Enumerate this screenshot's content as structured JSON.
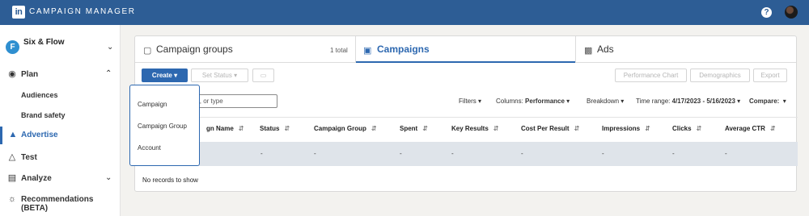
{
  "header": {
    "logo_text": "in",
    "app_title": "CAMPAIGN MANAGER",
    "help_label": "?"
  },
  "sidebar": {
    "account_name": "Six & Flow",
    "account_initial": "F",
    "items": [
      {
        "label": "Plan",
        "icon": "compass-icon"
      },
      {
        "label": "Audiences"
      },
      {
        "label": "Brand safety"
      },
      {
        "label": "Advertise",
        "icon": "megaphone-icon"
      },
      {
        "label": "Test",
        "icon": "flask-icon"
      },
      {
        "label": "Analyze",
        "icon": "bar-chart-icon"
      },
      {
        "label": "Recommendations (BETA)",
        "icon": "lightbulb-icon"
      }
    ]
  },
  "tabs": [
    {
      "label": "Campaign groups",
      "count": "1 total"
    },
    {
      "label": "Campaigns"
    },
    {
      "label": "Ads"
    }
  ],
  "toolbar": {
    "create": "Create",
    "set_status": "Set Status",
    "performance_chart": "Performance Chart",
    "demographics": "Demographics",
    "export": "Export"
  },
  "search": {
    "value": "D, or type"
  },
  "filters": {
    "filters": "Filters",
    "columns_label": "Columns:",
    "columns_value": "Performance",
    "breakdown": "Breakdown",
    "time_range_label": "Time range:",
    "time_range_value": "4/17/2023 - 5/16/2023",
    "compare": "Compare:"
  },
  "table": {
    "headers": [
      "gn Name",
      "Status",
      "Campaign Group",
      "Spent",
      "Key Results",
      "Cost Per Result",
      "Impressions",
      "Clicks",
      "Average CTR"
    ],
    "row": [
      "-",
      "-",
      "-",
      "-",
      "-",
      "-",
      "-",
      "-"
    ],
    "empty": "No records to show"
  },
  "dropdown": [
    "Campaign",
    "Campaign Group",
    "Account"
  ],
  "colors": {
    "brand": "#2d5d95",
    "accent": "#2d68b0"
  }
}
